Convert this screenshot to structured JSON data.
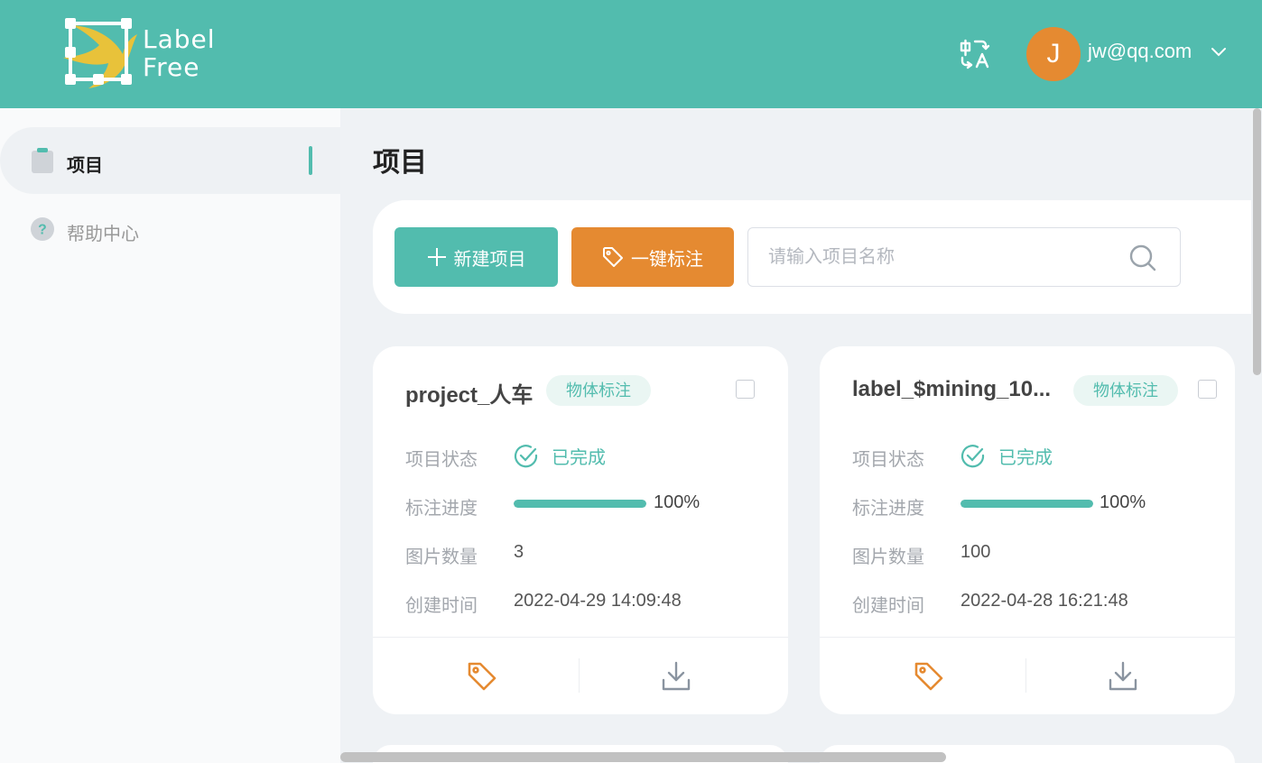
{
  "header": {
    "logo_line1": "Label",
    "logo_line2": "Free",
    "language_icon": "language-translate-icon",
    "user": {
      "avatar_initial": "J",
      "email": "jw@qq.com"
    },
    "colors": {
      "header_bg": "#52bcae",
      "avatar_bg": "#e58a31"
    }
  },
  "sidebar": {
    "items": [
      {
        "label": "项目",
        "icon": "clipboard-icon",
        "active": true
      },
      {
        "label": "帮助中心",
        "icon": "question-circle-icon",
        "active": false
      }
    ]
  },
  "main": {
    "title": "项目",
    "toolbar": {
      "new_project_label": "新建项目",
      "quick_label_label": "一键标注",
      "search_placeholder": "请输入项目名称",
      "search_value": ""
    },
    "cards": [
      {
        "name": "project_人车",
        "type_tag": "物体标注",
        "status_label": "项目状态",
        "status": "已完成",
        "progress_label": "标注进度",
        "progress": 1.0,
        "progress_text": "100%",
        "image_count_label": "图片数量",
        "image_count": "3",
        "created_label": "创建时间",
        "created": "2022-04-29 14:09:48"
      },
      {
        "name": "label_$mining_10...",
        "type_tag": "物体标注",
        "status_label": "项目状态",
        "status": "已完成",
        "progress_label": "标注进度",
        "progress": 1.0,
        "progress_text": "100%",
        "image_count_label": "图片数量",
        "image_count": "100",
        "created_label": "创建时间",
        "created": "2022-04-28 16:21:48"
      }
    ],
    "colors": {
      "accent": "#52bcae",
      "orange": "#e58a31"
    }
  }
}
